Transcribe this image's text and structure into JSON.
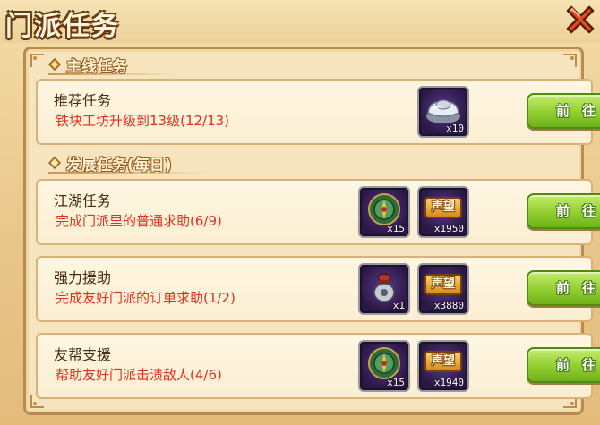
{
  "window": {
    "title": "门派任务",
    "close_icon": "close-x-icon"
  },
  "sections": {
    "main": {
      "label": "主线任务"
    },
    "daily": {
      "label": "发展任务(每日)"
    }
  },
  "tasks": [
    {
      "name": "推荐任务",
      "desc": "铁块工坊升级到13级(12/13)",
      "rewards": [
        {
          "icon": "silver-ingot-icon",
          "qty": "x10"
        }
      ],
      "button": "前往"
    },
    {
      "name": "江湖任务",
      "desc": "完成门派里的普通求助(6/9)",
      "rewards": [
        {
          "icon": "jade-compass-icon",
          "qty": "x15"
        },
        {
          "icon": "fame-icon",
          "label": "声望",
          "qty": "x1950"
        }
      ],
      "button": "前往"
    },
    {
      "name": "强力援助",
      "desc": "完成友好门派的订单求助(1/2)",
      "rewards": [
        {
          "icon": "token-pouch-icon",
          "qty": "x1"
        },
        {
          "icon": "fame-icon",
          "label": "声望",
          "qty": "x3880"
        }
      ],
      "button": "前往"
    },
    {
      "name": "友帮支援",
      "desc": "帮助友好门派击溃敌人(4/6)",
      "rewards": [
        {
          "icon": "jade-compass-icon",
          "qty": "x15"
        },
        {
          "icon": "fame-icon",
          "label": "声望",
          "qty": "x1940"
        }
      ],
      "button": "前往"
    }
  ],
  "colors": {
    "accent_green": "#8fcf2e",
    "progress_red": "#e2301e",
    "title_brown": "#6b3a12"
  }
}
